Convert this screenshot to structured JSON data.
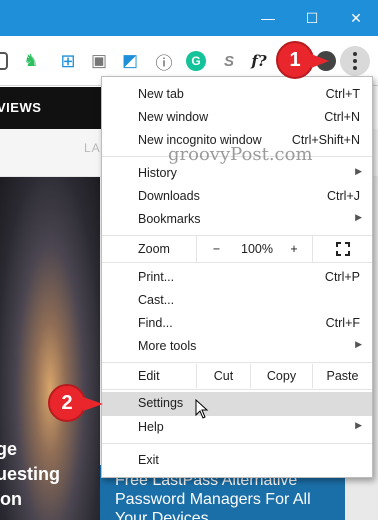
{
  "window": {
    "minimize_glyph": "—",
    "maximize_glyph": "☐",
    "close_glyph": "✕"
  },
  "toolbar": {
    "extensions": [
      {
        "icon": "evernote-icon",
        "glyph": "♞",
        "color": "#2dbe60"
      },
      {
        "icon": "windows-icon",
        "glyph": "⊞",
        "color": "#1e8fd8"
      },
      {
        "icon": "save-icon",
        "glyph": "▣",
        "color": "#777777"
      },
      {
        "icon": "window-icon",
        "glyph": "◩",
        "color": "#1e8fd8"
      },
      {
        "icon": "lastpass-icon",
        "glyph": "ⓘ",
        "color": "#555555"
      },
      {
        "icon": "grammarly-icon",
        "glyph": "G",
        "color": "#15c39a"
      },
      {
        "icon": "s-icon",
        "glyph": "S",
        "color": "#888888"
      },
      {
        "icon": "formula-icon",
        "glyph": "f?",
        "color": "#222222"
      }
    ]
  },
  "page": {
    "nav_black_text": "VIEWS",
    "nav_gray_text": "LA",
    "photo_lines": [
      "ge",
      "uesting",
      "on"
    ],
    "ad_lines": [
      "Free LastPass Alternative",
      "Password Managers For All",
      "Your Devices"
    ]
  },
  "watermark": "groovyPost.com",
  "annotations": {
    "one": "1",
    "two": "2"
  },
  "menu": {
    "group1": [
      {
        "label": "New tab",
        "shortcut": "Ctrl+T"
      },
      {
        "label": "New window",
        "shortcut": "Ctrl+N"
      },
      {
        "label": "New incognito window",
        "shortcut": "Ctrl+Shift+N"
      }
    ],
    "group2": [
      {
        "label": "History",
        "shortcut": "",
        "submenu": true
      },
      {
        "label": "Downloads",
        "shortcut": "Ctrl+J",
        "submenu": false
      },
      {
        "label": "Bookmarks",
        "shortcut": "",
        "submenu": true
      }
    ],
    "zoom": {
      "label": "Zoom",
      "minus": "−",
      "value": "100%",
      "plus": "+",
      "fullscreen": "⛶"
    },
    "group3": [
      {
        "label": "Print...",
        "shortcut": "Ctrl+P",
        "submenu": false
      },
      {
        "label": "Cast...",
        "shortcut": "",
        "submenu": false
      },
      {
        "label": "Find...",
        "shortcut": "Ctrl+F",
        "submenu": false
      },
      {
        "label": "More tools",
        "shortcut": "",
        "submenu": true
      }
    ],
    "edit": {
      "label": "Edit",
      "cut": "Cut",
      "copy": "Copy",
      "paste": "Paste"
    },
    "group4": [
      {
        "label": "Settings",
        "shortcut": "",
        "submenu": false,
        "highlighted": true
      },
      {
        "label": "Help",
        "shortcut": "",
        "submenu": true
      }
    ],
    "exit": {
      "label": "Exit"
    },
    "submenu_glyph": "▶"
  }
}
